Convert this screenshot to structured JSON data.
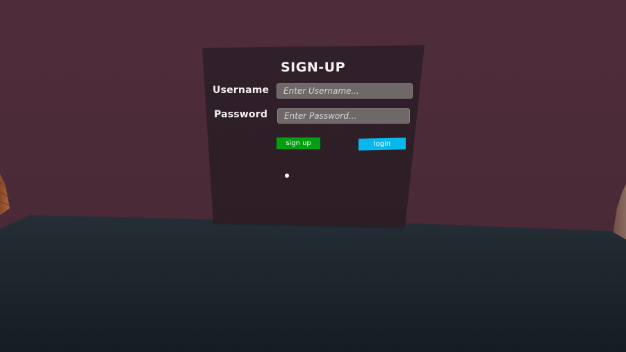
{
  "signup_form": {
    "title": "SIGN-UP",
    "username_label": "Username",
    "username_placeholder": "Enter Username...",
    "password_label": "Password",
    "password_placeholder": "Enter Password...",
    "signup_label": "sign up",
    "login_label": "login"
  },
  "colors": {
    "wall": "#4d2b38",
    "panel": "#2e1d23",
    "floor": "#1a2026",
    "signup_button": "#00a00f",
    "login_button": "#08b7ee",
    "input_field": "#6e6869"
  }
}
